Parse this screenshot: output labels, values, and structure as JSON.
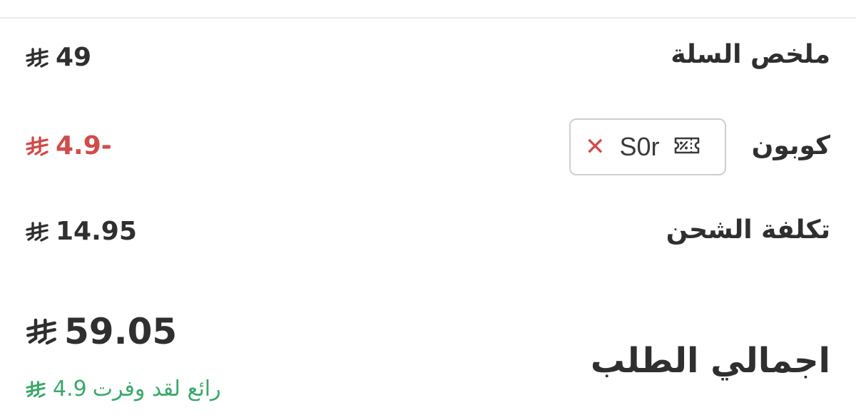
{
  "summary": {
    "cart_label": "ملخص السلة",
    "cart_amount": "49",
    "coupon_label": "كوبون",
    "coupon_code": "S0r",
    "coupon_discount": "4.9-",
    "shipping_label": "تكلفة الشحن",
    "shipping_amount": "14.95",
    "total_label": "اجمالي الطلب",
    "total_amount": "59.05",
    "saved_text": "رائع لقد وفرت",
    "saved_amount": "4.9"
  },
  "icons": {
    "currency": "riyal-icon",
    "coupon": "coupon-ticket-icon",
    "remove": "close-icon"
  },
  "colors": {
    "text": "#2f2f2f",
    "discount": "#d24b4b",
    "saved": "#3aa86b",
    "chip_border": "#cfcfcf"
  }
}
